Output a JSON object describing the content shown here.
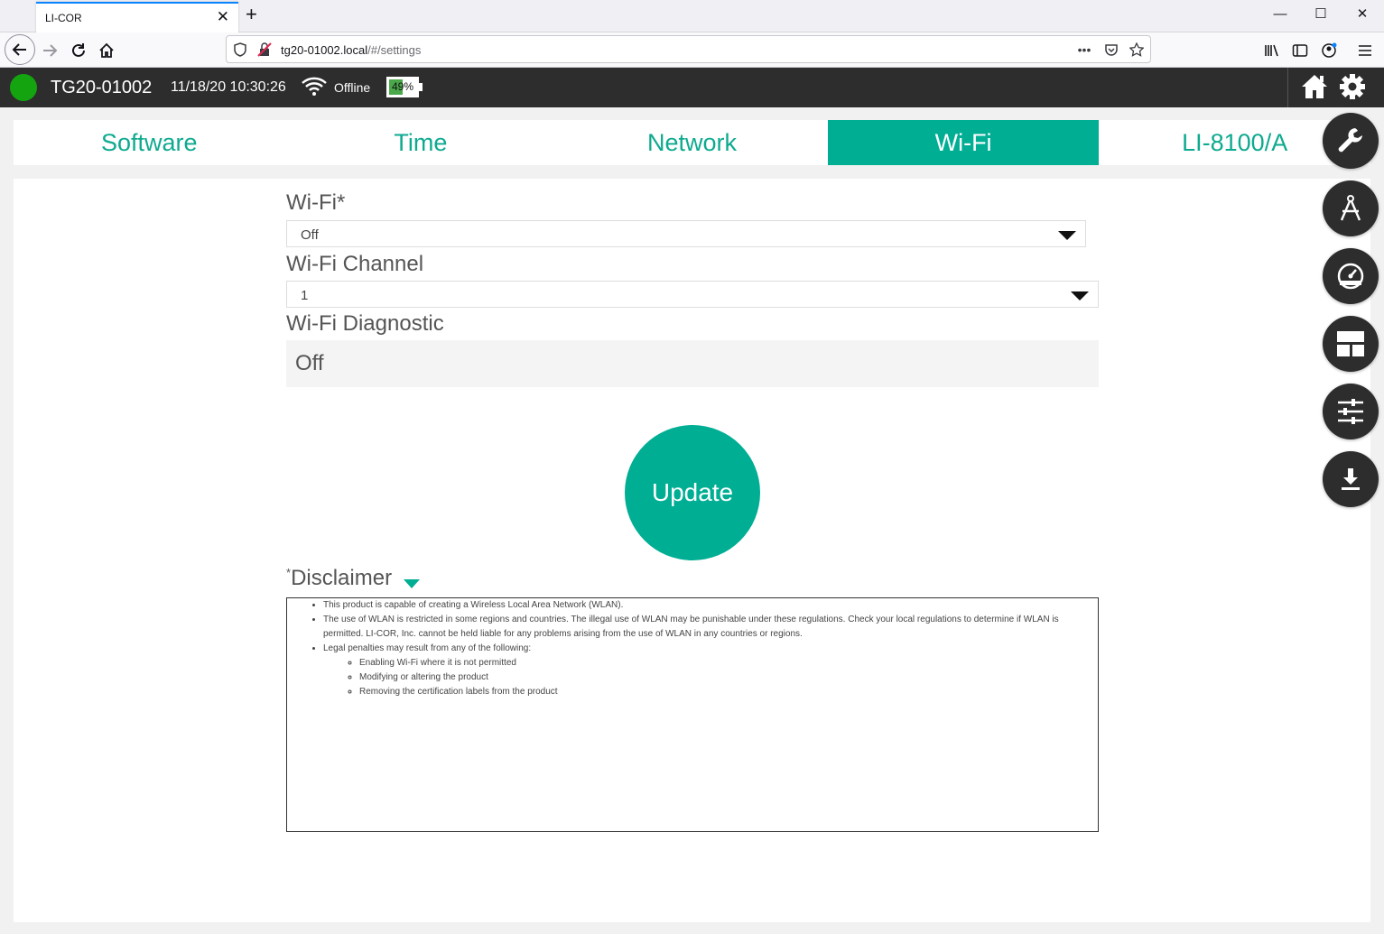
{
  "browser": {
    "tab_title": "LI-COR",
    "tab_close": "✕",
    "new_tab": "+",
    "url_host": "tg20-01002.local",
    "url_path": "/#/settings",
    "url_more": "•••",
    "window_minimize": "—",
    "window_maximize": "☐",
    "window_close": "✕"
  },
  "header": {
    "device_name": "TG20-01002",
    "datetime": "11/18/20 10:30:26",
    "connection_status": "Offline",
    "battery_label": "49%",
    "battery_level": 49,
    "status_color": "#14a40f"
  },
  "tabs": [
    {
      "label": "Software",
      "active": false
    },
    {
      "label": "Time",
      "active": false
    },
    {
      "label": "Network",
      "active": false
    },
    {
      "label": "Wi-Fi",
      "active": true
    },
    {
      "label": "LI-8100/A",
      "active": false
    }
  ],
  "form": {
    "wifi_label": "Wi-Fi*",
    "wifi_value": "Off",
    "channel_label": "Wi-Fi Channel",
    "channel_value": "1",
    "diagnostic_label": "Wi-Fi Diagnostic",
    "diagnostic_value": "Off",
    "update_label": "Update"
  },
  "disclaimer": {
    "asterisk": "*",
    "title": "Disclaimer",
    "items": [
      "This product is capable of creating a Wireless Local Area Network (WLAN).",
      "The use of WLAN is restricted in some regions and countries. The illegal use of WLAN may be punishable under these regulations. Check your local regulations to determine if WLAN is permitted. LI-COR, Inc. cannot be held liable for any problems arising from the use of WLAN in any countries or regions.",
      "Legal penalties may result from any of the following:"
    ],
    "subitems": [
      "Enabling Wi-Fi where it is not permitted",
      "Modifying or altering the product",
      "Removing the certification labels from the product"
    ]
  },
  "side_buttons": [
    "wrench-icon",
    "compass-icon",
    "gauge-icon",
    "layout-icon",
    "sliders-icon",
    "download-icon"
  ],
  "colors": {
    "accent": "#00ae94",
    "header_bg": "#2d2d2d",
    "status_green": "#14a40f"
  }
}
